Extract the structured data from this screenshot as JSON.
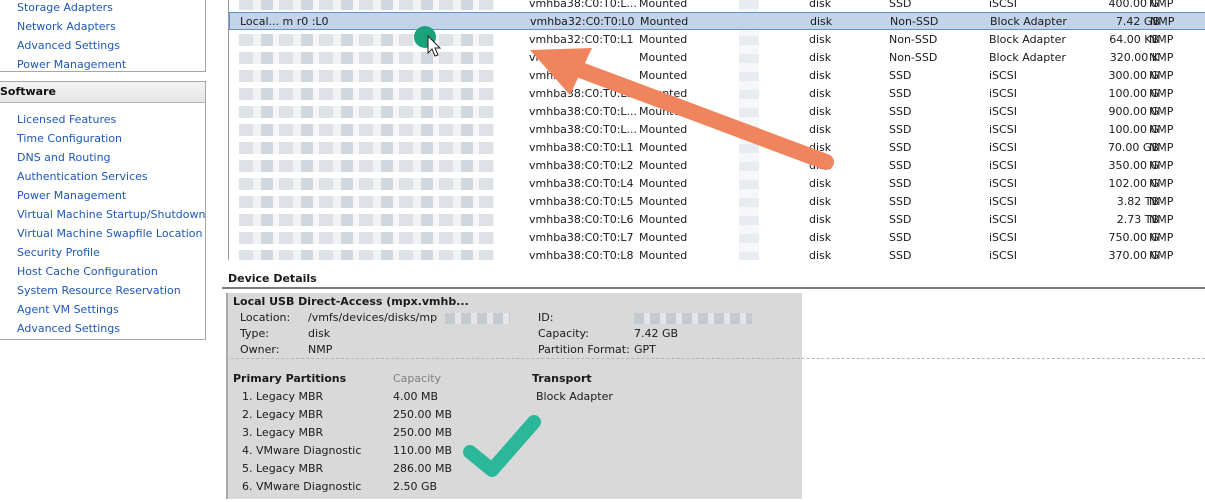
{
  "left_nav": {
    "hardware_items": [
      {
        "label": "Storage Adapters"
      },
      {
        "label": "Network Adapters"
      },
      {
        "label": "Advanced Settings"
      },
      {
        "label": "Power Management"
      }
    ],
    "software_header": "Software",
    "software_items": [
      {
        "label": "Licensed Features"
      },
      {
        "label": "Time Configuration"
      },
      {
        "label": "DNS and Routing"
      },
      {
        "label": "Authentication Services"
      },
      {
        "label": "Power Management"
      },
      {
        "label": "Virtual Machine Startup/Shutdown"
      },
      {
        "label": "Virtual Machine Swapfile Location"
      },
      {
        "label": "Security Profile"
      },
      {
        "label": "Host Cache Configuration"
      },
      {
        "label": "System Resource Reservation"
      },
      {
        "label": "Agent VM Settings"
      },
      {
        "label": "Advanced Settings"
      }
    ]
  },
  "device_table": {
    "rows": [
      {
        "name": "",
        "runtime": "vmhba38:C0:T0:L...",
        "status": "Mounted",
        "type": "disk",
        "drive": "SSD",
        "transport": "iSCSI",
        "capacity": "400.00 G",
        "owner": "NMP",
        "selected": false
      },
      {
        "name": "Local...  m           r0  :L0",
        "runtime": "vmhba32:C0:T0:L0",
        "status": "Mounted",
        "type": "disk",
        "drive": "Non-SSD",
        "transport": "Block Adapter",
        "capacity": "7.42 GB",
        "owner": "NMP",
        "selected": true
      },
      {
        "name": "",
        "runtime": "vmhba32:C0:T0:L1",
        "status": "Mounted",
        "type": "disk",
        "drive": "Non-SSD",
        "transport": "Block Adapter",
        "capacity": "64.00 KB",
        "owner": "NMP",
        "selected": false
      },
      {
        "name": "",
        "runtime": "vm     :T0:L2",
        "status": "Mounted",
        "type": "disk",
        "drive": "Non-SSD",
        "transport": "Block Adapter",
        "capacity": "320.00 K",
        "owner": "NMP",
        "selected": false
      },
      {
        "name": "",
        "runtime": "vmhba3",
        "status": "Mounted",
        "type": "disk",
        "drive": "SSD",
        "transport": "iSCSI",
        "capacity": "300.00 G",
        "owner": "NMP",
        "selected": false
      },
      {
        "name": "",
        "runtime": "vmhba38:C0:T0:L...",
        "status": "Mounted",
        "type": "disk",
        "drive": "SSD",
        "transport": "iSCSI",
        "capacity": "100.00 G",
        "owner": "NMP",
        "selected": false
      },
      {
        "name": "",
        "runtime": "vmhba38:C0:T0:L...",
        "status": "Mounted",
        "type": "disk",
        "drive": "SSD",
        "transport": "iSCSI",
        "capacity": "900.00 G",
        "owner": "NMP",
        "selected": false
      },
      {
        "name": "",
        "runtime": "vmhba38:C0:T0:L...",
        "status": "Mounted",
        "type": "disk",
        "drive": "SSD",
        "transport": "iSCSI",
        "capacity": "100.00 G",
        "owner": "NMP",
        "selected": false
      },
      {
        "name": "",
        "runtime": "vmhba38:C0:T0:L1",
        "status": "Mounted",
        "type": "disk",
        "drive": "SSD",
        "transport": "iSCSI",
        "capacity": "70.00 GB",
        "owner": "NMP",
        "selected": false
      },
      {
        "name": "",
        "runtime": "vmhba38:C0:T0:L2",
        "status": "Mounted",
        "type": "disk",
        "drive": "SSD",
        "transport": "iSCSI",
        "capacity": "350.00 G",
        "owner": "NMP",
        "selected": false
      },
      {
        "name": "",
        "runtime": "vmhba38:C0:T0:L4",
        "status": "Mounted",
        "type": "disk",
        "drive": "SSD",
        "transport": "iSCSI",
        "capacity": "102.00 G",
        "owner": "NMP",
        "selected": false
      },
      {
        "name": "",
        "runtime": "vmhba38:C0:T0:L5",
        "status": "Mounted",
        "type": "disk",
        "drive": "SSD",
        "transport": "iSCSI",
        "capacity": "3.82 TB",
        "owner": "NMP",
        "selected": false
      },
      {
        "name": "",
        "runtime": "vmhba38:C0:T0:L6",
        "status": "Mounted",
        "type": "disk",
        "drive": "SSD",
        "transport": "iSCSI",
        "capacity": "2.73 TB",
        "owner": "NMP",
        "selected": false
      },
      {
        "name": "",
        "runtime": "vmhba38:C0:T0:L7",
        "status": "Mounted",
        "type": "disk",
        "drive": "SSD",
        "transport": "iSCSI",
        "capacity": "750.00 G",
        "owner": "NMP",
        "selected": false
      },
      {
        "name": "",
        "runtime": "vmhba38:C0:T0:L8",
        "status": "Mounted",
        "type": "disk",
        "drive": "SSD",
        "transport": "iSCSI",
        "capacity": "370.00 G",
        "owner": "NMP",
        "selected": false
      }
    ]
  },
  "device_details": {
    "section_title": "Device Details",
    "device_name": "Local USB Direct-Access (mpx.vmhb...",
    "location_label": "Location:",
    "location_value": "/vmfs/devices/disks/mp",
    "type_label": "Type:",
    "type_value": "disk",
    "owner_label": "Owner:",
    "owner_value": "NMP",
    "id_label": "ID:",
    "capacity_label": "Capacity:",
    "capacity_value": "7.42 GB",
    "partition_format_label": "Partition Format:",
    "partition_format_value": "GPT",
    "partitions_header": "Primary Partitions",
    "capacity_header": "Capacity",
    "transport_header": "Transport",
    "transport_value": "Block Adapter",
    "partitions": [
      {
        "name": "1. Legacy MBR",
        "capacity": "4.00 MB"
      },
      {
        "name": "2. Legacy MBR",
        "capacity": "250.00 MB"
      },
      {
        "name": "3. Legacy MBR",
        "capacity": "250.00 MB"
      },
      {
        "name": "4. VMware Diagnostic",
        "capacity": "110.00 MB"
      },
      {
        "name": "5. Legacy MBR",
        "capacity": "286.00 MB"
      },
      {
        "name": "6. VMware Diagnostic",
        "capacity": "2.50 GB"
      }
    ]
  },
  "annotations": {
    "arrow_color": "#f0845c",
    "checkmark_color": "#2bb79a",
    "cursor_dot_color": "#1aa37a",
    "arrow_icon": "pointer-arrow-icon",
    "check_icon": "checkmark-icon"
  }
}
